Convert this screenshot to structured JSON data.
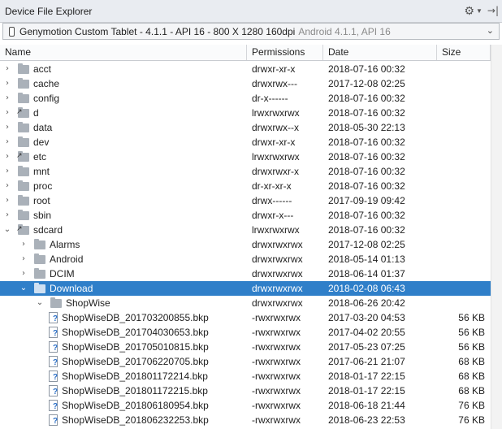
{
  "titlebar": {
    "title": "Device File Explorer",
    "icons": [
      "gear-icon",
      "chevron-down-icon",
      "pin-icon"
    ]
  },
  "device": {
    "name": "Genymotion Custom Tablet - 4.1.1 - API 16 - 800 X 1280 160dpi",
    "extra": "Android 4.1.1, API 16"
  },
  "columns": [
    "Name",
    "Permissions",
    "Date",
    "Size"
  ],
  "rows": [
    {
      "name": "acct",
      "perm": "drwxr-xr-x",
      "date": "2018-07-16 00:32",
      "size": "",
      "kind": "folder",
      "depth": 0,
      "expanded": false
    },
    {
      "name": "cache",
      "perm": "drwxrwx---",
      "date": "2017-12-08 02:25",
      "size": "",
      "kind": "folder",
      "depth": 0,
      "expanded": false
    },
    {
      "name": "config",
      "perm": "dr-x------",
      "date": "2018-07-16 00:32",
      "size": "",
      "kind": "folder",
      "depth": 0,
      "expanded": false
    },
    {
      "name": "d",
      "perm": "lrwxrwxrwx",
      "date": "2018-07-16 00:32",
      "size": "",
      "kind": "link",
      "depth": 0,
      "expanded": false
    },
    {
      "name": "data",
      "perm": "drwxrwx--x",
      "date": "2018-05-30 22:13",
      "size": "",
      "kind": "folder",
      "depth": 0,
      "expanded": false
    },
    {
      "name": "dev",
      "perm": "drwxr-xr-x",
      "date": "2018-07-16 00:32",
      "size": "",
      "kind": "folder",
      "depth": 0,
      "expanded": false
    },
    {
      "name": "etc",
      "perm": "lrwxrwxrwx",
      "date": "2018-07-16 00:32",
      "size": "",
      "kind": "link",
      "depth": 0,
      "expanded": false
    },
    {
      "name": "mnt",
      "perm": "drwxrwxr-x",
      "date": "2018-07-16 00:32",
      "size": "",
      "kind": "folder",
      "depth": 0,
      "expanded": false
    },
    {
      "name": "proc",
      "perm": "dr-xr-xr-x",
      "date": "2018-07-16 00:32",
      "size": "",
      "kind": "folder",
      "depth": 0,
      "expanded": false
    },
    {
      "name": "root",
      "perm": "drwx------",
      "date": "2017-09-19 09:42",
      "size": "",
      "kind": "folder",
      "depth": 0,
      "expanded": false
    },
    {
      "name": "sbin",
      "perm": "drwxr-x---",
      "date": "2018-07-16 00:32",
      "size": "",
      "kind": "folder",
      "depth": 0,
      "expanded": false
    },
    {
      "name": "sdcard",
      "perm": "lrwxrwxrwx",
      "date": "2018-07-16 00:32",
      "size": "",
      "kind": "link",
      "depth": 0,
      "expanded": true
    },
    {
      "name": "Alarms",
      "perm": "drwxrwxrwx",
      "date": "2017-12-08 02:25",
      "size": "",
      "kind": "folder",
      "depth": 1,
      "expanded": false
    },
    {
      "name": "Android",
      "perm": "drwxrwxrwx",
      "date": "2018-05-14 01:13",
      "size": "",
      "kind": "folder",
      "depth": 1,
      "expanded": false
    },
    {
      "name": "DCIM",
      "perm": "drwxrwxrwx",
      "date": "2018-06-14 01:37",
      "size": "",
      "kind": "folder",
      "depth": 1,
      "expanded": false
    },
    {
      "name": "Download",
      "perm": "drwxrwxrwx",
      "date": "2018-02-08 06:43",
      "size": "",
      "kind": "folder",
      "depth": 1,
      "expanded": true,
      "selected": true
    },
    {
      "name": "ShopWise",
      "perm": "drwxrwxrwx",
      "date": "2018-06-26 20:42",
      "size": "",
      "kind": "folder",
      "depth": 2,
      "expanded": true
    },
    {
      "name": "ShopWiseDB_201703200855.bkp",
      "perm": "-rwxrwxrwx",
      "date": "2017-03-20 04:53",
      "size": "56 KB",
      "kind": "file",
      "depth": 3
    },
    {
      "name": "ShopWiseDB_201704030653.bkp",
      "perm": "-rwxrwxrwx",
      "date": "2017-04-02 20:55",
      "size": "56 KB",
      "kind": "file",
      "depth": 3
    },
    {
      "name": "ShopWiseDB_201705010815.bkp",
      "perm": "-rwxrwxrwx",
      "date": "2017-05-23 07:25",
      "size": "56 KB",
      "kind": "file",
      "depth": 3
    },
    {
      "name": "ShopWiseDB_201706220705.bkp",
      "perm": "-rwxrwxrwx",
      "date": "2017-06-21 21:07",
      "size": "68 KB",
      "kind": "file",
      "depth": 3
    },
    {
      "name": "ShopWiseDB_201801172214.bkp",
      "perm": "-rwxrwxrwx",
      "date": "2018-01-17 22:15",
      "size": "68 KB",
      "kind": "file",
      "depth": 3
    },
    {
      "name": "ShopWiseDB_201801172215.bkp",
      "perm": "-rwxrwxrwx",
      "date": "2018-01-17 22:15",
      "size": "68 KB",
      "kind": "file",
      "depth": 3
    },
    {
      "name": "ShopWiseDB_201806180954.bkp",
      "perm": "-rwxrwxrwx",
      "date": "2018-06-18 21:44",
      "size": "76 KB",
      "kind": "file",
      "depth": 3
    },
    {
      "name": "ShopWiseDB_201806232253.bkp",
      "perm": "-rwxrwxrwx",
      "date": "2018-06-23 22:53",
      "size": "76 KB",
      "kind": "file",
      "depth": 3
    }
  ],
  "colors": {
    "selection": "#2f7fc9",
    "folder": "#aab1b9"
  }
}
